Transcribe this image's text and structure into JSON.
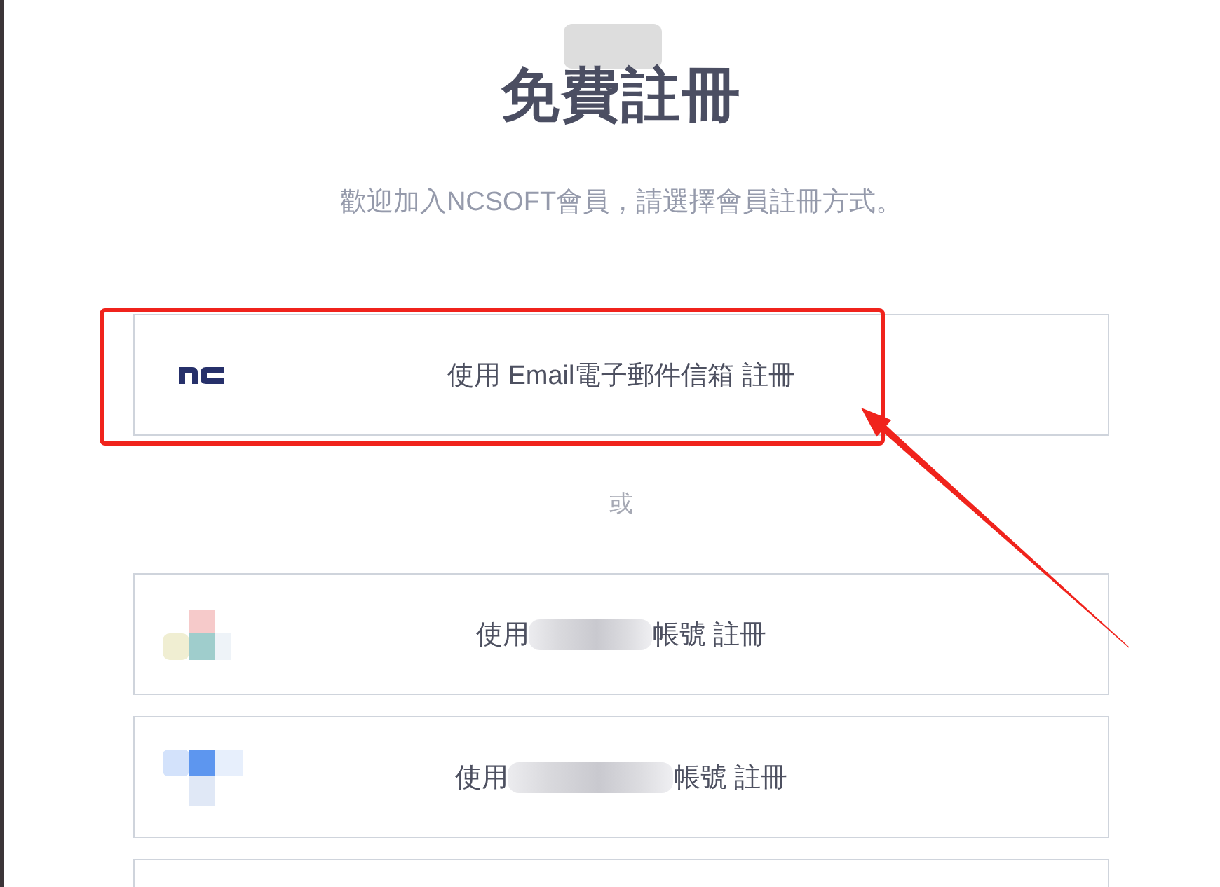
{
  "header": {
    "title": "免費註冊",
    "subtitle": "歡迎加入NCSOFT會員，請選擇會員註冊方式。"
  },
  "primary_option": {
    "kind": "ncsoft",
    "label": "使用 Email電子郵件信箱 註冊",
    "highlighted": true
  },
  "divider_text": "或",
  "other_options": [
    {
      "kind": "mosaicwarm",
      "label_before": "使用",
      "label_after": "帳號 註冊"
    },
    {
      "kind": "mosaicblue",
      "label_before": "使用",
      "label_after": "帳號 註冊"
    },
    {
      "kind": "blank"
    }
  ]
}
